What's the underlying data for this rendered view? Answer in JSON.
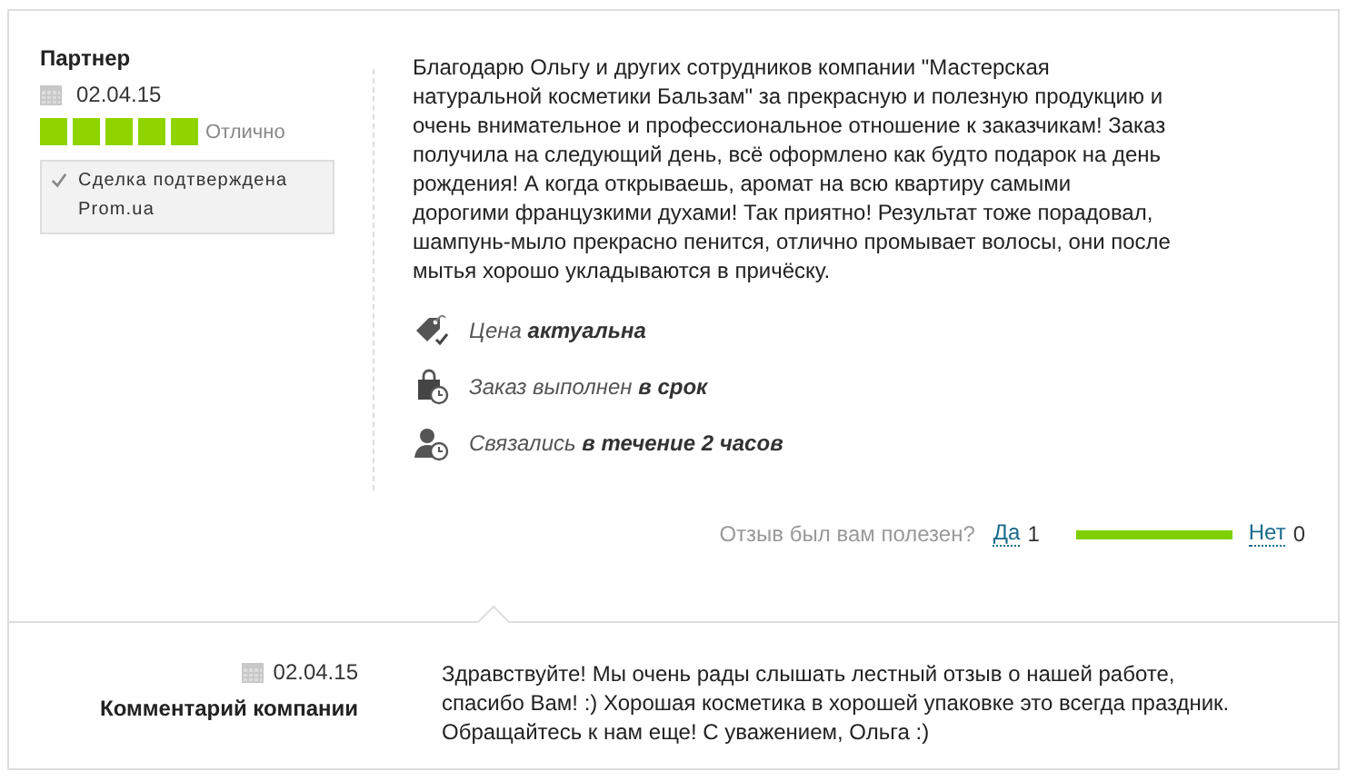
{
  "review": {
    "author": "Партнер",
    "date": "02.04.15",
    "stars": 5,
    "rating_label": "Отлично",
    "verified": {
      "checked": true,
      "text": "Сделка подтверждена",
      "source": "Prom.ua"
    },
    "text": "Благодарю Ольгу и других сотрудников компании \"Мастерская натуральной косметики Бальзам\" за прекрасную и полезную продукцию и очень внимательное и профессиональное отношение к заказчикам! Заказ получила на следующий день, всё оформлено как будто подарок на день рождения! А когда открываешь, аромат на всю квартиру самыми дорогими французкими духами! Так приятно! Результат тоже порадовал, шампунь-мыло прекрасно пенится, отлично промывает волосы, они после мытья хорошо укладываются в причёску.",
    "features": [
      {
        "kind": "price",
        "text": "Цена **актуальна**"
      },
      {
        "kind": "order",
        "text": "Заказ выполнен **в срок**"
      },
      {
        "kind": "contact",
        "text": "Связались **в течение 2 часов**"
      }
    ],
    "helpful": {
      "question": "Отзыв был вам полезен?",
      "yes_label": "Да",
      "yes_count": "1",
      "level": 1,
      "no_label": "Нет",
      "no_count": "0"
    }
  },
  "company_reply": {
    "date": "02.04.15",
    "title": "Комментарий компании",
    "text": "Здравствуйте! Мы очень рады слышать лестный отзыв о нашей работе, спасибо Вам! :) Хорошая косметика в хорошей упаковке это всегда праздник. Обращайтесь к нам еще! С уважением, Ольга :)"
  }
}
